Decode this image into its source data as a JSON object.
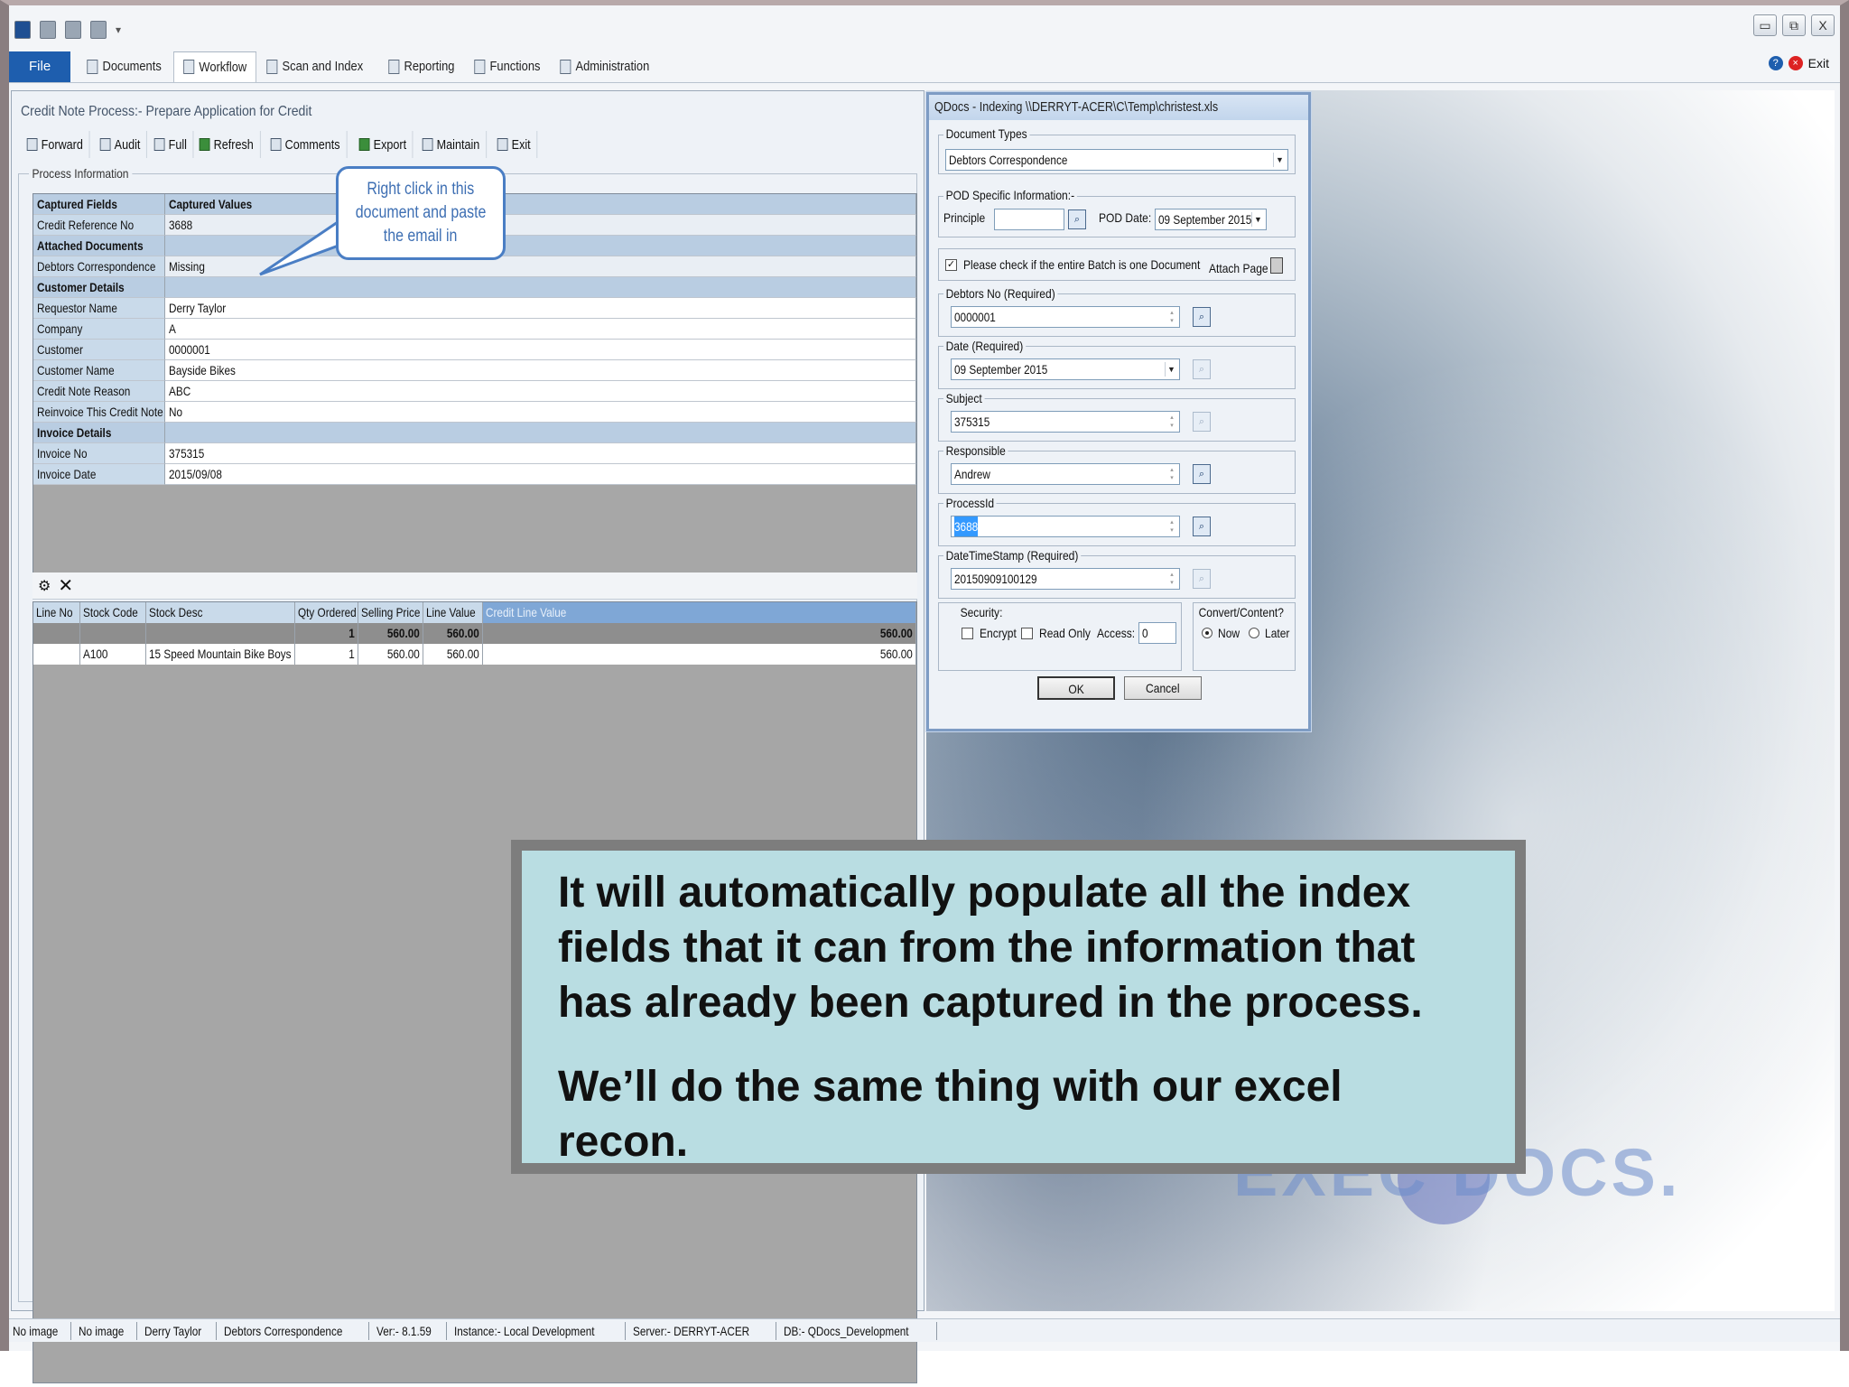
{
  "ribbon": {
    "file": "File",
    "tabs": [
      "Documents",
      "Workflow",
      "Scan and Index",
      "Reporting",
      "Functions",
      "Administration"
    ],
    "exit": "Exit"
  },
  "window_controls": [
    "▭",
    "⧉",
    "X"
  ],
  "workflow": {
    "title": "Credit Note Process:- Prepare Application for Credit",
    "toolbar": [
      "Forward",
      "Audit",
      "Full",
      "Refresh",
      "Comments",
      "Export",
      "Maintain",
      "Exit"
    ],
    "group_label": "Process Information",
    "callout": [
      "Right click in this",
      "document and paste",
      "the email in"
    ],
    "grid": [
      {
        "type": "header",
        "field": "Captured Fields",
        "value": "Captured Values"
      },
      {
        "type": "field",
        "field": "Credit Reference No",
        "value": "3688"
      },
      {
        "type": "header",
        "field": "Attached Documents",
        "value": ""
      },
      {
        "type": "field",
        "field": "Debtors Correspondence",
        "value": "Missing"
      },
      {
        "type": "header",
        "field": "Customer Details",
        "value": ""
      },
      {
        "type": "field",
        "field": "Requestor Name",
        "value": "Derry Taylor"
      },
      {
        "type": "field",
        "field": "Company",
        "value": "A"
      },
      {
        "type": "field",
        "field": "Customer",
        "value": "0000001"
      },
      {
        "type": "field",
        "field": "Customer Name",
        "value": "Bayside Bikes"
      },
      {
        "type": "field",
        "field": "Credit Note Reason",
        "value": "ABC"
      },
      {
        "type": "field",
        "field": "Reinvoice This Credit Note",
        "value": "No"
      },
      {
        "type": "header",
        "field": "Invoice Details",
        "value": ""
      },
      {
        "type": "field",
        "field": "Invoice No",
        "value": "375315"
      },
      {
        "type": "field",
        "field": "Invoice Date",
        "value": "2015/09/08"
      }
    ],
    "lines": {
      "columns": [
        "Line No",
        "Stock Code",
        "Stock Desc",
        "Qty Ordered",
        "Selling Price",
        "Line Value",
        "Credit Line Value"
      ],
      "totals": [
        "",
        "",
        "",
        "1",
        "560.00",
        "560.00",
        "560.00"
      ],
      "rows": [
        [
          "",
          "A100",
          "15 Speed Mountain Bike Boys",
          "1",
          "560.00",
          "560.00",
          "560.00"
        ]
      ]
    }
  },
  "dialog": {
    "title": "QDocs - Indexing \\\\DERRYT-ACER\\C\\Temp\\christest.xls",
    "document_types_label": "Document Types",
    "document_type": "Debtors Correspondence",
    "pod_label": "POD Specific Information:-",
    "principle_label": "Principle",
    "principle_value": "",
    "pod_date_label": "POD Date:",
    "pod_date_value": "09 September 2015",
    "batch_check_label": "Please check if the entire Batch is one Document",
    "attach_page": "Attach Page",
    "fields": [
      {
        "label": "Debtors No (Required)",
        "value": "0000001",
        "lookup": true
      },
      {
        "label": "Date (Required)",
        "value": "09 September 2015",
        "lookup": false
      },
      {
        "label": "Subject",
        "value": "375315",
        "lookup": false
      },
      {
        "label": "Responsible",
        "value": "Andrew",
        "lookup": true
      },
      {
        "label": "ProcessId",
        "value": "3688",
        "lookup": true
      },
      {
        "label": "DateTimeStamp (Required)",
        "value": "20150909100129",
        "lookup": false
      }
    ],
    "security_label": "Security:",
    "encrypt": "Encrypt",
    "read_only": "Read Only",
    "access_label": "Access:",
    "access_value": "0",
    "convert_label": "Convert/Content?",
    "now": "Now",
    "later": "Later",
    "ok": "OK",
    "cancel": "Cancel"
  },
  "note": {
    "p1": "It will automatically populate all the index fields that it can from the information that has already been captured in the process.",
    "p2": "We’ll do the same thing with our excel recon."
  },
  "logo_text": "EXEC  DOCS.",
  "status": [
    "No image",
    "No image",
    "Derry Taylor",
    "Debtors Correspondence",
    "Ver:- 8.1.59",
    "Instance:- Local Development",
    "Server:- DERRYT-ACER",
    "DB:- QDocs_Development"
  ]
}
